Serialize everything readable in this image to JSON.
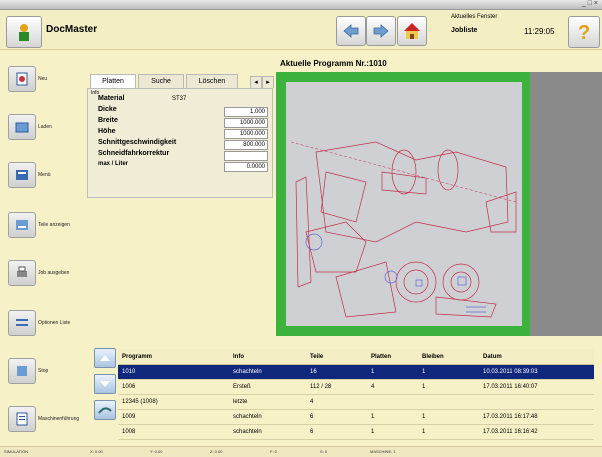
{
  "window": {
    "title": "",
    "controls": "_ □ ×"
  },
  "header": {
    "app_name": "DocMaster",
    "user_caption": "Aktuelles Fenster",
    "user_value": "Jobliste",
    "time": "11:29:05"
  },
  "sidebar": {
    "items": [
      {
        "label": "Neu",
        "icon": "new-doc-icon"
      },
      {
        "label": "Laden",
        "icon": "open-icon"
      },
      {
        "label": "Menü",
        "icon": "menu-icon"
      },
      {
        "label": "Teile anzeigen",
        "icon": "parts-icon"
      },
      {
        "label": "Job ausgeben",
        "icon": "print-icon"
      },
      {
        "label": "Optionen Liste",
        "icon": "options-icon"
      },
      {
        "label": "Stop",
        "icon": "stop-icon"
      },
      {
        "label": "Maschinenführung",
        "icon": "machine-icon"
      }
    ]
  },
  "tabs": [
    {
      "label": "Platten"
    },
    {
      "label": "Suche"
    },
    {
      "label": "Löschen"
    }
  ],
  "info": {
    "section_label": "Info",
    "fields": [
      {
        "label": "Material",
        "value": "ST37"
      },
      {
        "label": "Dicke",
        "value": "1.000"
      },
      {
        "label": "Breite",
        "value": "1000.000"
      },
      {
        "label": "Höhe",
        "value": "1000.000"
      },
      {
        "label": "Schnittgeschwindigkeit",
        "value": "800.000"
      },
      {
        "label": "Schneidfahrkorrektur",
        "value": ""
      },
      {
        "label": "max / Liter",
        "value": "0.0000"
      }
    ]
  },
  "viewer": {
    "title": "Aktuelle Programm Nr.:1010"
  },
  "table": {
    "columns": [
      "Programm",
      "Info",
      "Teile",
      "Platten",
      "Bleiben",
      "Datum"
    ],
    "rows": [
      {
        "programm": "1010",
        "info": "schachteln",
        "teile": "16",
        "platten": "1",
        "bleiben": "1",
        "datum": "10.03.2011 08:39:03",
        "selected": true
      },
      {
        "programm": "1006",
        "info": "Ersteß",
        "teile": "112 / 28",
        "platten": "4",
        "bleiben": "1",
        "datum": "17.03.2011 16:40:07",
        "selected": false
      },
      {
        "programm": "12345 (1008)",
        "info": "letzte",
        "teile": "4",
        "platten": "",
        "bleiben": "",
        "datum": "",
        "selected": false
      },
      {
        "programm": "1009",
        "info": "schachteln",
        "teile": "6",
        "platten": "1",
        "bleiben": "1",
        "datum": "17.03.2011 16:17:48",
        "selected": false
      },
      {
        "programm": "1008",
        "info": "schachteln",
        "teile": "6",
        "platten": "1",
        "bleiben": "1",
        "datum": "17.03.2011 16:16:42",
        "selected": false
      }
    ]
  },
  "status": [
    "SIMULATION",
    "X: 0.00",
    "Y: 0.00",
    "Z: 0.00",
    "F: 0",
    "S: 0",
    "MASCHINE: 1"
  ],
  "colors": {
    "accent_selected": "#10287c",
    "frame_green": "#3cb33c",
    "background": "#f7f1c8"
  }
}
